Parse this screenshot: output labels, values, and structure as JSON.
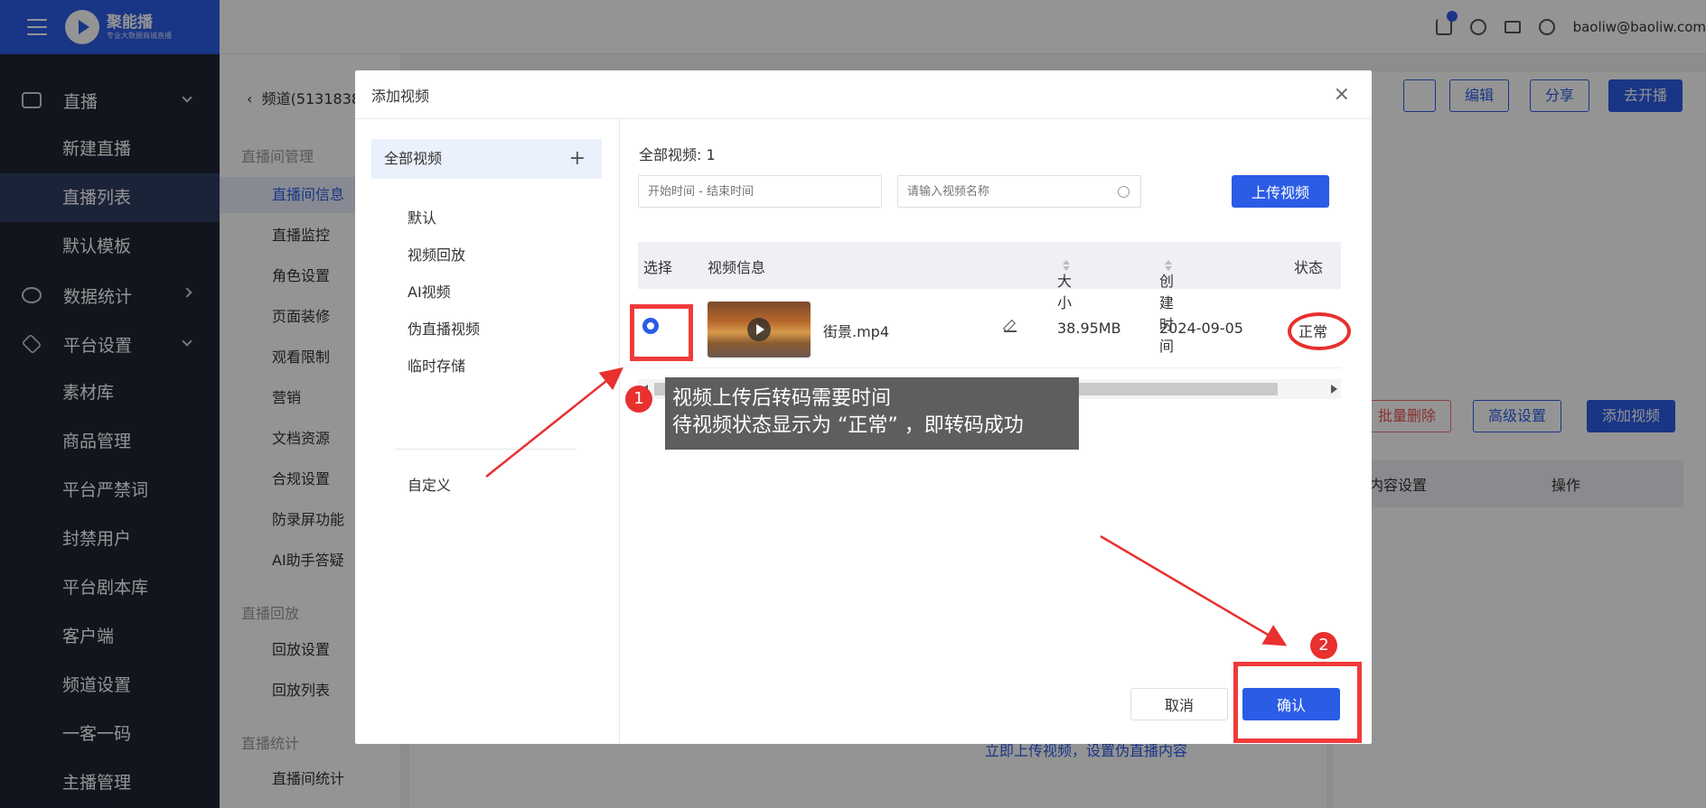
{
  "app": {
    "logo_name": "聚能播",
    "logo_sub": "专业大数据商城直播",
    "user_email": "baoliw@baoliw.com"
  },
  "leftnav": {
    "groups": [
      {
        "label": "直播",
        "icon": "video-camera-icon",
        "items": [
          "新建直播",
          "直播列表",
          "默认模板"
        ],
        "active": "直播列表"
      },
      {
        "label": "数据统计",
        "icon": "stats-icon",
        "items": []
      },
      {
        "label": "平台设置",
        "icon": "layers-icon",
        "items": [
          "素材库",
          "商品管理",
          "平台严禁词",
          "封禁用户",
          "平台剧本库",
          "客户端",
          "频道设置",
          "一客一码",
          "主播管理"
        ]
      }
    ]
  },
  "subnav": {
    "breadcrumb": "频道(5131838",
    "section_room": "直播间管理",
    "room_items": [
      "直播间信息",
      "直播监控",
      "角色设置",
      "页面装修",
      "观看限制",
      "营销",
      "文档资源",
      "合规设置",
      "防录屏功能",
      "AI助手答疑"
    ],
    "section_replay": "直播回放",
    "replay_items": [
      "回放设置",
      "回放列表"
    ],
    "section_stats": "直播统计",
    "stats_items": [
      "直播间统计"
    ]
  },
  "background": {
    "buttons": {
      "edit": "编辑",
      "share": "分享",
      "go_live": "去开播",
      "batch_delete": "批量删除",
      "advanced": "高级设置",
      "add_video": "添加视频"
    },
    "table_headers": {
      "content_setting": "内容设置",
      "actions": "操作"
    },
    "link": "立即上传视频，设置伪直播内容"
  },
  "modal": {
    "title": "添加视频",
    "close": "×",
    "folders": {
      "all": "全部视频",
      "add": "+",
      "items": [
        "默认",
        "视频回放",
        "AI视频",
        "伪直播视频",
        "临时存储"
      ],
      "custom": "自定义"
    },
    "total_label": "全部视频:",
    "total_count": "1",
    "date_placeholder": "开始时间 - 结束时间",
    "search_placeholder": "请输入视频名称",
    "upload_button": "上传视频",
    "table": {
      "headers": {
        "select": "选择",
        "info": "视频信息",
        "size": "大小",
        "created": "创建时间",
        "status": "状态"
      },
      "rows": [
        {
          "name": "街景.mp4",
          "size": "38.95MB",
          "created": "2024-09-05",
          "status": "正常",
          "selected": true
        }
      ]
    },
    "cancel_button": "取消",
    "confirm_button": "确认"
  },
  "annotations": {
    "step1": "1",
    "step2": "2",
    "tooltip_line1": "视频上传后转码需要时间",
    "tooltip_line2": "待视频状态显示为 “正常” ，即转码成功",
    "highlight_color": "#e8302f"
  },
  "colors": {
    "brand": "#2b5ce6",
    "nav_bg": "#1f2535",
    "overlay": "rgba(0,0,0,0.42)"
  }
}
